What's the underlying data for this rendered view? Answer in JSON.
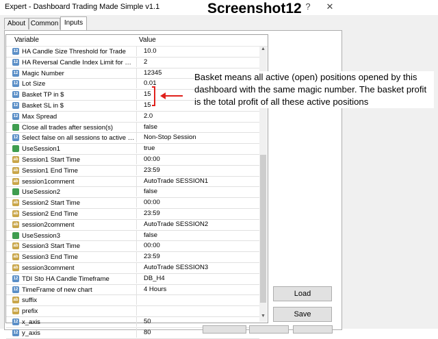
{
  "window": {
    "title": "Expert - Dashboard Trading Made Simple v1.1",
    "overlay_label": "Screenshot12",
    "help_glyph": "?",
    "close_glyph": "✕"
  },
  "tabs": [
    {
      "label": "About"
    },
    {
      "label": "Common"
    },
    {
      "label": "Inputs"
    }
  ],
  "grid": {
    "col_variable": "Variable",
    "col_value": "Value",
    "rows": [
      {
        "icon": "blue",
        "icon_text": "12",
        "variable": "HA Candle Size Threshold for Trade",
        "value": "10.0"
      },
      {
        "icon": "blue",
        "icon_text": "12",
        "variable": "HA Reversal Candle Index Limit for Tr...",
        "value": "2"
      },
      {
        "icon": "blue",
        "icon_text": "12",
        "variable": "Magic Number",
        "value": "12345"
      },
      {
        "icon": "blue",
        "icon_text": "12",
        "variable": "Lot Size",
        "value": "0.01"
      },
      {
        "icon": "blue",
        "icon_text": "12",
        "variable": "Basket TP in $",
        "value": "15"
      },
      {
        "icon": "blue",
        "icon_text": "12",
        "variable": "Basket SL in $",
        "value": "15"
      },
      {
        "icon": "blue",
        "icon_text": "12",
        "variable": "Max Spread",
        "value": "2.0"
      },
      {
        "icon": "green",
        "icon_text": "",
        "variable": "Close all trades after session(s)",
        "value": "false"
      },
      {
        "icon": "blue",
        "icon_text": "12",
        "variable": "Select false on all sessions to active n...",
        "value": "Non-Stop Session"
      },
      {
        "icon": "green",
        "icon_text": "",
        "variable": "UseSession1",
        "value": "true"
      },
      {
        "icon": "ab",
        "icon_text": "ab",
        "variable": "Session1 Start Time",
        "value": "00:00"
      },
      {
        "icon": "ab",
        "icon_text": "ab",
        "variable": "Session1 End Time",
        "value": "23:59"
      },
      {
        "icon": "ab",
        "icon_text": "ab",
        "variable": "session1comment",
        "value": "AutoTrade SESSION1"
      },
      {
        "icon": "green",
        "icon_text": "",
        "variable": "UseSession2",
        "value": "false"
      },
      {
        "icon": "ab",
        "icon_text": "ab",
        "variable": "Session2 Start Time",
        "value": "00:00"
      },
      {
        "icon": "ab",
        "icon_text": "ab",
        "variable": "Session2 End Time",
        "value": "23:59"
      },
      {
        "icon": "ab",
        "icon_text": "ab",
        "variable": "session2comment",
        "value": "AutoTrade SESSION2"
      },
      {
        "icon": "green",
        "icon_text": "",
        "variable": "UseSession3",
        "value": "false"
      },
      {
        "icon": "ab",
        "icon_text": "ab",
        "variable": "Session3 Start Time",
        "value": "00:00"
      },
      {
        "icon": "ab",
        "icon_text": "ab",
        "variable": "Session3 End Time",
        "value": "23:59"
      },
      {
        "icon": "ab",
        "icon_text": "ab",
        "variable": "session3comment",
        "value": "AutoTrade SESSION3"
      },
      {
        "icon": "blue",
        "icon_text": "12",
        "variable": "TDI Sto HA Candle Timeframe",
        "value": "DB_H4"
      },
      {
        "icon": "blue",
        "icon_text": "12",
        "variable": "TimeFrame of new chart",
        "value": "4 Hours"
      },
      {
        "icon": "ab",
        "icon_text": "ab",
        "variable": "suffix",
        "value": ""
      },
      {
        "icon": "ab",
        "icon_text": "ab",
        "variable": "prefix",
        "value": ""
      },
      {
        "icon": "blue",
        "icon_text": "12",
        "variable": "x_axis",
        "value": "50"
      },
      {
        "icon": "blue",
        "icon_text": "12",
        "variable": "y_axis",
        "value": "80"
      }
    ]
  },
  "buttons": {
    "load": "Load",
    "save": "Save"
  },
  "annotation": {
    "text": "Basket means all active (open) positions opened by this dashboard with the same magic number.  The basket profit is the total profit of all these active positions",
    "color": "#e0201b"
  }
}
